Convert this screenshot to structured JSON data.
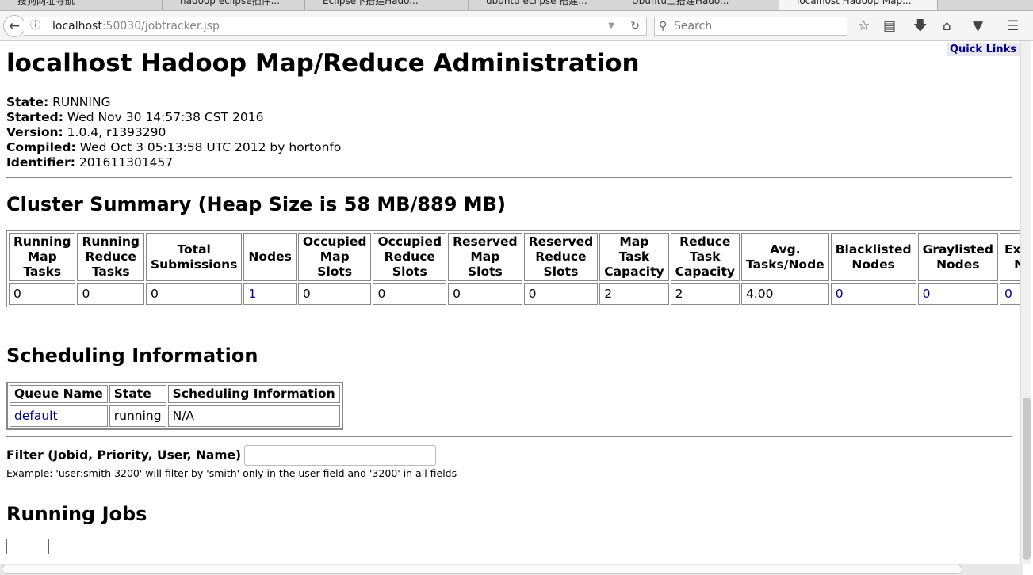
{
  "browser": {
    "tabs": [
      {
        "title": "搜狗网址导航"
      },
      {
        "title": "hadoop eclipse插件..."
      },
      {
        "title": "Eclipse下搭建Hado..."
      },
      {
        "title": "ubuntu eclipse 搭建..."
      },
      {
        "title": "Ubuntu上搭建Hado..."
      },
      {
        "title": "localhost Hadoop Map...",
        "active": true
      }
    ],
    "url_host": "localhost",
    "url_rest": ":50030/jobtracker.jsp",
    "search_placeholder": "Search"
  },
  "page": {
    "quick_links": "Quick Links",
    "title": "localhost Hadoop Map/Reduce Administration",
    "info": [
      {
        "label": "State:",
        "value": " RUNNING"
      },
      {
        "label": "Started:",
        "value": " Wed Nov 30 14:57:38 CST 2016"
      },
      {
        "label": "Version:",
        "value": " 1.0.4, r1393290"
      },
      {
        "label": "Compiled:",
        "value": " Wed Oct 3 05:13:58 UTC 2012 by hortonfo"
      },
      {
        "label": "Identifier:",
        "value": " 201611301457"
      }
    ],
    "cluster_title": "Cluster Summary (Heap Size is 58 MB/889 MB)",
    "cluster_headers": [
      "Running Map Tasks",
      "Running Reduce Tasks",
      "Total Submissions",
      "Nodes",
      "Occupied Map Slots",
      "Occupied Reduce Slots",
      "Reserved Map Slots",
      "Reserved Reduce Slots",
      "Map Task Capacity",
      "Reduce Task Capacity",
      "Avg. Tasks/Node",
      "Blacklisted Nodes",
      "Graylisted Nodes",
      "Excluded Nodes"
    ],
    "cluster_values": [
      "0",
      "0",
      "0",
      "1",
      "0",
      "0",
      "0",
      "0",
      "2",
      "2",
      "4.00",
      "0",
      "0",
      "0"
    ],
    "scheduling_title": "Scheduling Information",
    "sched_headers": [
      "Queue Name",
      "State",
      "Scheduling Information"
    ],
    "sched_row": [
      "default",
      "running",
      "N/A"
    ],
    "filter_label": "Filter (Jobid, Priority, User, Name)",
    "filter_example": "Example: 'user:smith 3200' will filter by 'smith' only in the user field and '3200' in all fields",
    "running_jobs_title": "Running Jobs"
  }
}
